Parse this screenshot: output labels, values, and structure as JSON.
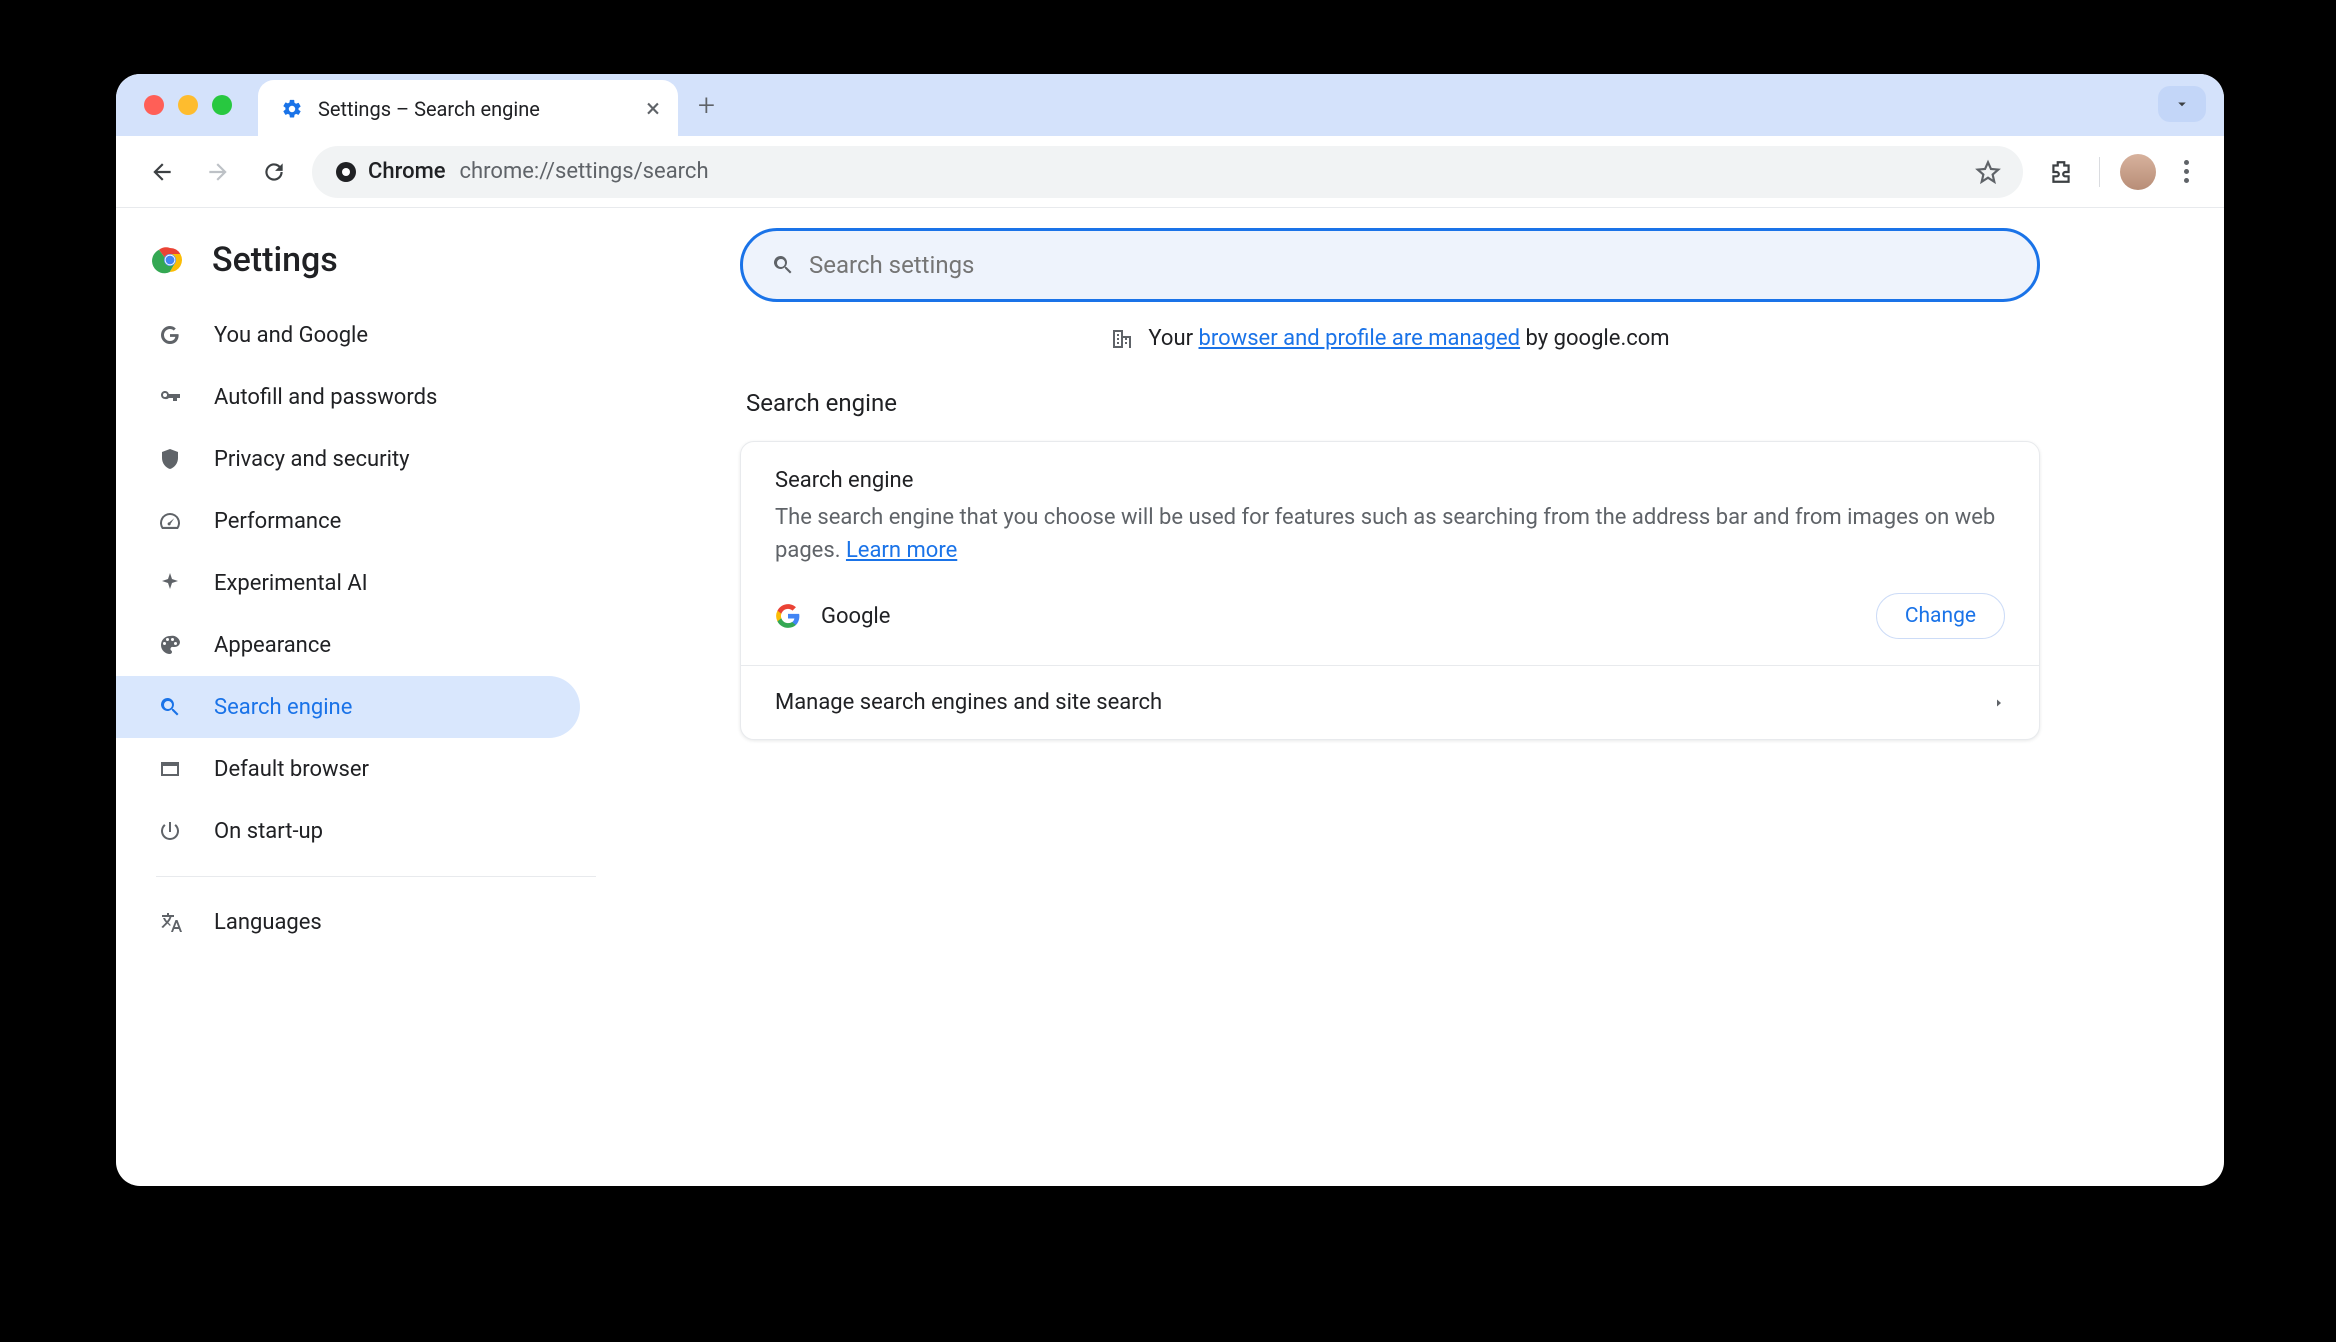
{
  "browser": {
    "tab_title": "Settings – Search engine",
    "url_prefix": "Chrome",
    "url": "chrome://settings/search"
  },
  "sidebar": {
    "title": "Settings",
    "items": [
      {
        "label": "You and Google"
      },
      {
        "label": "Autofill and passwords"
      },
      {
        "label": "Privacy and security"
      },
      {
        "label": "Performance"
      },
      {
        "label": "Experimental AI"
      },
      {
        "label": "Appearance"
      },
      {
        "label": "Search engine"
      },
      {
        "label": "Default browser"
      },
      {
        "label": "On start-up"
      }
    ],
    "secondary": [
      {
        "label": "Languages"
      }
    ]
  },
  "main": {
    "search_placeholder": "Search settings",
    "managed_prefix": "Your ",
    "managed_link": "browser and profile are managed",
    "managed_suffix": " by google.com",
    "section_title": "Search engine",
    "card": {
      "heading": "Search engine",
      "description": "The search engine that you choose will be used for features such as searching from the address bar and from images on web pages. ",
      "learn_more": "Learn more",
      "current_engine": "Google",
      "change_button": "Change",
      "manage_link": "Manage search engines and site search"
    }
  }
}
